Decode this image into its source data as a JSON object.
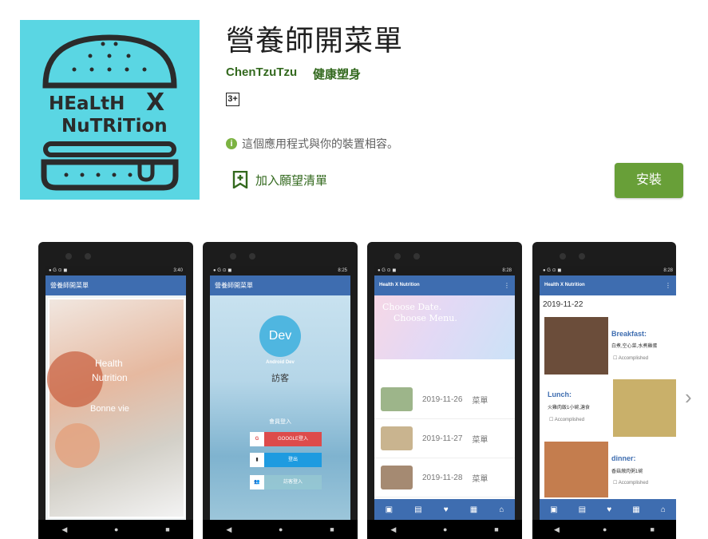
{
  "app": {
    "title": "營養師開菜單",
    "developer": "ChenTzuTzu",
    "category": "健康塑身",
    "content_rating": "3+",
    "compat_text": "這個應用程式與你的裝置相容。",
    "wishlist_label": "加入願望清單",
    "install_label": "安裝",
    "icon_text_line1": "HEaLtH",
    "icon_text_x": "X",
    "icon_text_line2": "NuTRiTion",
    "colors": {
      "accent": "#689f38",
      "link": "#33691e",
      "icon_bg": "#5ad6e3"
    }
  },
  "screenshots": {
    "s1": {
      "time": "3:40",
      "appbar": "營養師開菜單",
      "line1": "Health",
      "line2": "Nutrition",
      "line3": "Bonne vie"
    },
    "s2": {
      "time": "8:25",
      "appbar": "營養師開菜單",
      "dev_badge": "Dev",
      "dev_sub": "Android Dev",
      "guest": "訪客",
      "member_login": "會員登入",
      "google_login": "GOOGLE登入",
      "btn2": "登出",
      "btn3": "訪客登入"
    },
    "s3": {
      "time": "8:28",
      "brand": "Health X Nutrition",
      "banner1": "Choose Date.",
      "banner2": "Choose Menu.",
      "items": [
        {
          "date": "2019-11-26",
          "label": "菜單"
        },
        {
          "date": "2019-11-27",
          "label": "菜單"
        },
        {
          "date": "2019-11-28",
          "label": "菜單"
        }
      ]
    },
    "s4": {
      "time": "8:28",
      "brand": "Health X Nutrition",
      "date": "2019-11-22",
      "breakfast_title": "Breakfast:",
      "breakfast_text": "白煮,空心菜,水煮雞蛋",
      "lunch_title": "Lunch:",
      "lunch_text": "火雞肉飯1小碗,溏食",
      "dinner_title": "dinner:",
      "dinner_text": "香菇燉肉粥1碗",
      "accomplished": "Accomplished"
    }
  }
}
